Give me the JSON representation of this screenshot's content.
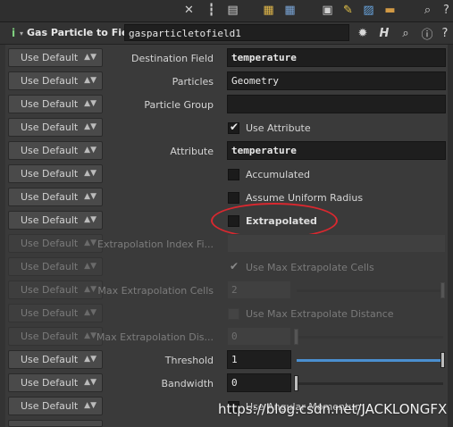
{
  "header": {
    "node_type": "Gas Particle to Field",
    "node_name": "gasparticletofield1",
    "info_icon": "info-icon"
  },
  "use_default_label": "Use Default",
  "params": {
    "destination_field": {
      "label": "Destination Field",
      "value": "temperature"
    },
    "particles": {
      "label": "Particles",
      "value": "Geometry"
    },
    "particle_group": {
      "label": "Particle Group",
      "value": ""
    },
    "use_attribute": {
      "label": "Use Attribute",
      "checked": true
    },
    "attribute": {
      "label": "Attribute",
      "value": "temperature"
    },
    "accumulated": {
      "label": "Accumulated",
      "checked": false
    },
    "assume_uniform_radius": {
      "label": "Assume Uniform Radius",
      "checked": false
    },
    "extrapolated": {
      "label": "Extrapolated",
      "checked": false
    },
    "extrapolation_index_field": {
      "label": "Extrapolation Index Fi...",
      "value": ""
    },
    "use_max_extrapolate_cells": {
      "label": "Use Max Extrapolate Cells",
      "checked": true
    },
    "max_extrapolation_cells": {
      "label": "Max Extrapolation Cells",
      "value": "2",
      "slider_fraction": 0
    },
    "use_max_extrapolate_distance": {
      "label": "Use Max Extrapolate Distance",
      "checked": false
    },
    "max_extrapolation_distance": {
      "label": "Max Extrapolation Dis...",
      "value": "0",
      "slider_fraction": 0
    },
    "threshold": {
      "label": "Threshold",
      "value": "1",
      "slider_fraction": 1.0
    },
    "bandwidth": {
      "label": "Bandwidth",
      "value": "0",
      "slider_fraction": 0
    },
    "use_angular_momentum": {
      "label": "Use Angular Momentum",
      "checked": false
    }
  },
  "watermark": "https://blog.csdn.net/JACKLONGFX",
  "colors": {
    "annotation": "#d9282f",
    "slider_fill": "#4a8fd0"
  }
}
